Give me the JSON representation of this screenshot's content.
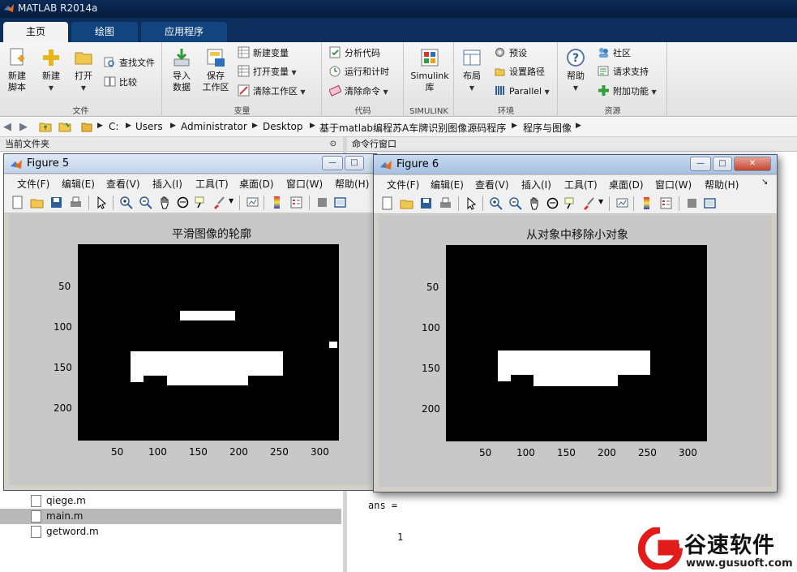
{
  "app": {
    "title": "MATLAB R2014a"
  },
  "tabs": [
    {
      "label": "主页",
      "active": true
    },
    {
      "label": "绘图",
      "active": false
    },
    {
      "label": "应用程序",
      "active": false
    }
  ],
  "ribbon": {
    "file_group": {
      "label": "文件",
      "new_script": "新建\n脚本",
      "new": "新建",
      "open": "打开",
      "find_files": "查找文件",
      "compare": "比较"
    },
    "variable_group": {
      "label": "变量",
      "import_data": "导入\n数据",
      "save_workspace": "保存\n工作区",
      "new_variable": "新建变量",
      "open_variable": "打开变量",
      "clear_workspace": "清除工作区"
    },
    "code_group": {
      "label": "代码",
      "analyze_code": "分析代码",
      "run_and_time": "运行和计时",
      "clear_commands": "清除命令"
    },
    "simulink_group": {
      "label": "SIMULINK",
      "library": "Simulink\n库"
    },
    "env_group": {
      "label": "环境",
      "layout": "布局",
      "preferences": "预设",
      "set_path": "设置路径",
      "parallel": "Parallel"
    },
    "resources_group": {
      "label": "资源",
      "help": "帮助",
      "community": "社区",
      "request_support": "请求支持",
      "addons": "附加功能"
    }
  },
  "path": [
    "C:",
    "Users",
    "Administrator",
    "Desktop",
    "基于matlab编程苏A车牌识别图像源码程序",
    "程序与图像"
  ],
  "panels": {
    "current_folder": "当前文件夹",
    "command_window": "命令行窗口"
  },
  "files": [
    {
      "name": "qiege.m",
      "selected": false
    },
    {
      "name": "main.m",
      "selected": true
    },
    {
      "name": "getword.m",
      "selected": false
    }
  ],
  "command_window": {
    "line1": "ans =",
    "line2": "1"
  },
  "figure_menu": [
    "文件(F)",
    "编辑(E)",
    "查看(V)",
    "插入(I)",
    "工具(T)",
    "桌面(D)",
    "窗口(W)",
    "帮助(H)"
  ],
  "figures": [
    {
      "title": "Figure 5",
      "axes_title": "平滑图像的轮廓",
      "yticks": [
        "50",
        "100",
        "150",
        "200"
      ],
      "xticks": [
        "50",
        "100",
        "150",
        "200",
        "250",
        "300"
      ]
    },
    {
      "title": "Figure 6",
      "axes_title": "从对象中移除小对象",
      "yticks": [
        "50",
        "100",
        "150",
        "200"
      ],
      "xticks": [
        "50",
        "100",
        "150",
        "200",
        "250",
        "300"
      ]
    }
  ],
  "watermark": {
    "text": "谷速软件",
    "url": "www.gusuoft.com"
  }
}
